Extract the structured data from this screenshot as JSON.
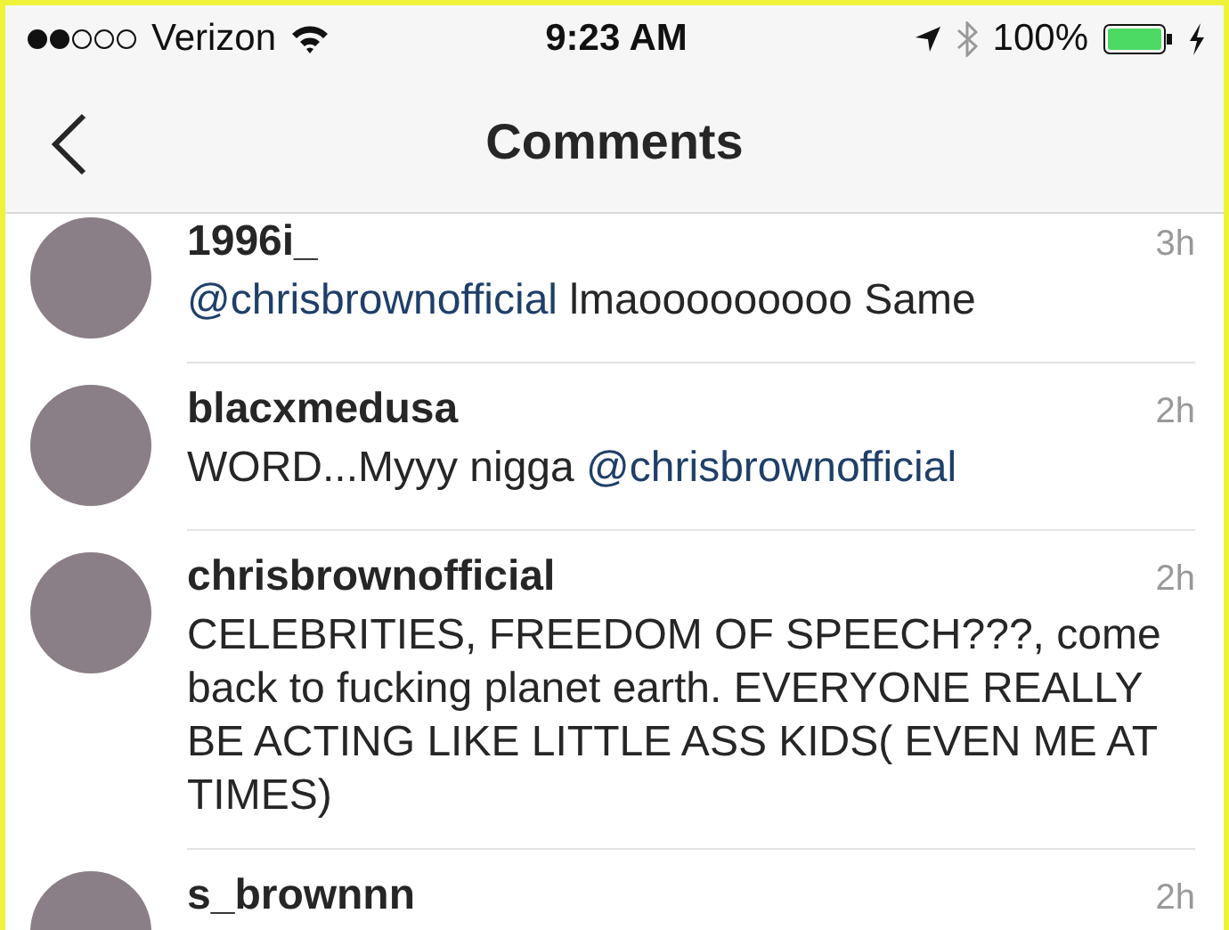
{
  "status_bar": {
    "carrier": "Verizon",
    "time": "9:23 AM",
    "battery": "100%"
  },
  "nav": {
    "title": "Comments"
  },
  "comments": [
    {
      "username": "1996i_",
      "time": "3h",
      "parts": [
        {
          "kind": "mention",
          "text": "@chrisbrownofficial"
        },
        {
          "kind": "plain",
          "text": " lmaooooooooo Same"
        }
      ]
    },
    {
      "username": "blacxmedusa",
      "time": "2h",
      "parts": [
        {
          "kind": "plain",
          "text": "WORD...Myyy nigga "
        },
        {
          "kind": "mention",
          "text": "@chrisbrownofficial"
        }
      ]
    },
    {
      "username": "chrisbrownofficial",
      "time": "2h",
      "parts": [
        {
          "kind": "plain",
          "text": "CELEBRITIES, FREEDOM OF SPEECH???, come back to fucking planet earth. EVERYONE REALLY BE ACTING LIKE LITTLE ASS KIDS( EVEN ME AT TIMES)"
        }
      ]
    },
    {
      "username": "s_brownnn",
      "time": "2h"
    }
  ]
}
